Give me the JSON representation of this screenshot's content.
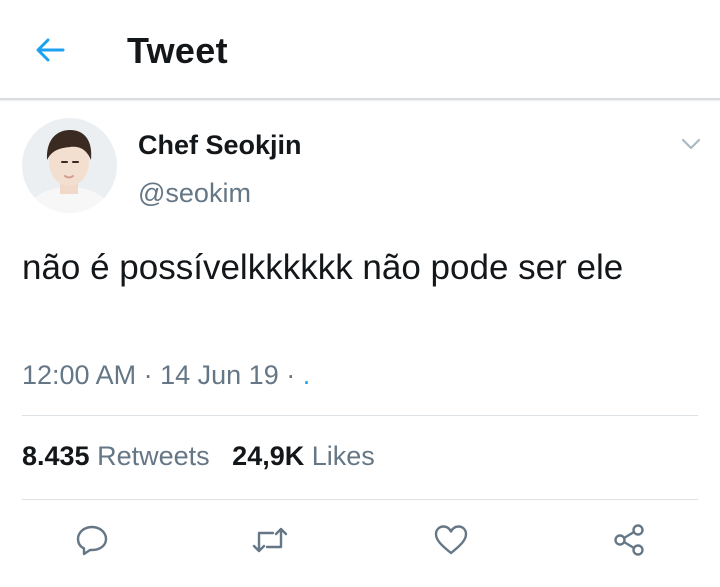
{
  "header": {
    "title": "Tweet",
    "back_icon": "arrow-left-icon",
    "accent_color": "#1da1f2"
  },
  "tweet": {
    "author_name": "Chef Seokjin",
    "author_handle": "@seokim",
    "menu_icon": "chevron-down-icon",
    "text": "não é possívelkkkkkk não pode ser ele",
    "time": "12:00 AM",
    "date": "14 Jun 19",
    "source": ".",
    "sep": "·"
  },
  "stats": {
    "retweets_count": "8.435",
    "retweets_label": "Retweets",
    "likes_count": "24,9K",
    "likes_label": "Likes"
  },
  "actions": [
    {
      "icon": "reply-icon"
    },
    {
      "icon": "retweet-icon"
    },
    {
      "icon": "like-icon"
    },
    {
      "icon": "share-icon"
    }
  ],
  "colors": {
    "text": "#14171a",
    "secondary": "#657786",
    "link": "#1da1f2",
    "divider": "#dde2e6"
  }
}
